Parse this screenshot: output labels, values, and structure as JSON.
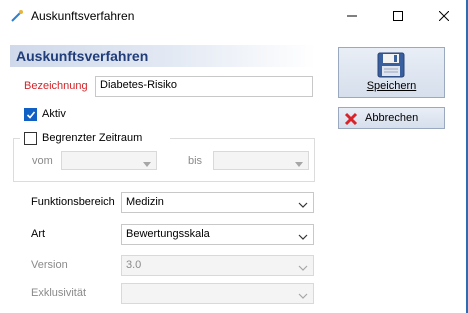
{
  "window": {
    "title": "Auskunftsverfahren"
  },
  "form": {
    "header": "Auskunftsverfahren",
    "bezeichnung_label": "Bezeichnung",
    "bezeichnung_value": "Diabetes-Risiko",
    "aktiv_label": "Aktiv",
    "aktiv_checked": true,
    "zeitraum_label": "Begrenzter Zeitraum",
    "zeitraum_checked": false,
    "vom_label": "vom",
    "bis_label": "bis",
    "vom_value": "",
    "bis_value": "",
    "funktionsbereich_label": "Funktionsbereich",
    "funktionsbereich_value": "Medizin",
    "art_label": "Art",
    "art_value": "Bewertungsskala",
    "version_label": "Version",
    "version_value": "3.0",
    "exklusivitaet_label": "Exklusivität",
    "exklusivitaet_value": ""
  },
  "buttons": {
    "save_label": "Speichern",
    "cancel_label": "Abbrechen"
  },
  "icons": {
    "app": "wand-icon",
    "minimize": "minimize-icon",
    "maximize": "maximize-icon",
    "close": "close-icon",
    "save": "floppy-disk-icon",
    "cancel": "red-x-icon"
  },
  "colors": {
    "required_label": "#d4262b",
    "header_text": "#203d7a",
    "checkbox": "#0f5fc4"
  }
}
